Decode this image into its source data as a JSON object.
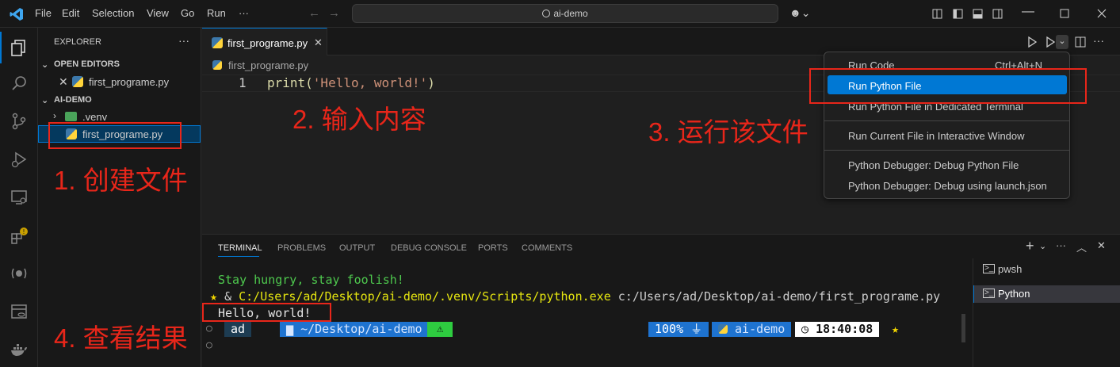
{
  "titlebar": {
    "menus": [
      "File",
      "Edit",
      "Selection",
      "View",
      "Go",
      "Run",
      "···"
    ],
    "search": "ai-demo"
  },
  "sidebar": {
    "title": "EXPLORER",
    "more": "···",
    "open_editors": "OPEN EDITORS",
    "open_file": "first_programe.py",
    "project": "AI-DEMO",
    "venv": ".venv",
    "file": "first_programe.py"
  },
  "editor": {
    "tab": "first_programe.py",
    "breadcrumb": "first_programe.py",
    "line_no": "1",
    "code_fn": "print(",
    "code_str": "'Hello, world!'",
    "code_end": ")"
  },
  "run_menu": {
    "items": [
      {
        "label": "Run Code",
        "shortcut": "Ctrl+Alt+N"
      },
      {
        "label": "Run Python File"
      },
      {
        "label": "Run Python File in Dedicated Terminal"
      },
      {
        "label": "Run Current File in Interactive Window"
      },
      {
        "label": "Python Debugger: Debug Python File"
      },
      {
        "label": "Python Debugger: Debug using launch.json"
      }
    ]
  },
  "panel": {
    "tabs": [
      "TERMINAL",
      "PROBLEMS",
      "OUTPUT",
      "DEBUG CONSOLE",
      "PORTS",
      "COMMENTS"
    ],
    "terminals": [
      "pwsh",
      "Python"
    ]
  },
  "terminal": {
    "motd": "Stay hungry, stay foolish!",
    "cmd_star": "★",
    "cmd_amp": "&",
    "cmd_exe": "C:/Users/ad/Desktop/ai-demo/.venv/Scripts/python.exe",
    "cmd_arg": "c:/Users/ad/Desktop/ai-demo/first_programe.py",
    "output": "Hello, world!",
    "prompt_user": "ad",
    "prompt_path": "~/Desktop/ai-demo",
    "prompt_warn": "⚠",
    "battery": "100%",
    "env": "ai-demo",
    "time": "18:40:08",
    "end_star": "★",
    "cursor": "○"
  },
  "annotations": {
    "a1": "1. 创建文件",
    "a2": "2. 输入内容",
    "a3": "3. 运行该文件",
    "a4": "4. 查看结果"
  },
  "colors": {
    "accent": "#0078d4",
    "annotation": "#e8261a",
    "prompt_green": "#2ecc40",
    "prompt_blue": "#1e90ff",
    "motd": "#4ec94e"
  }
}
